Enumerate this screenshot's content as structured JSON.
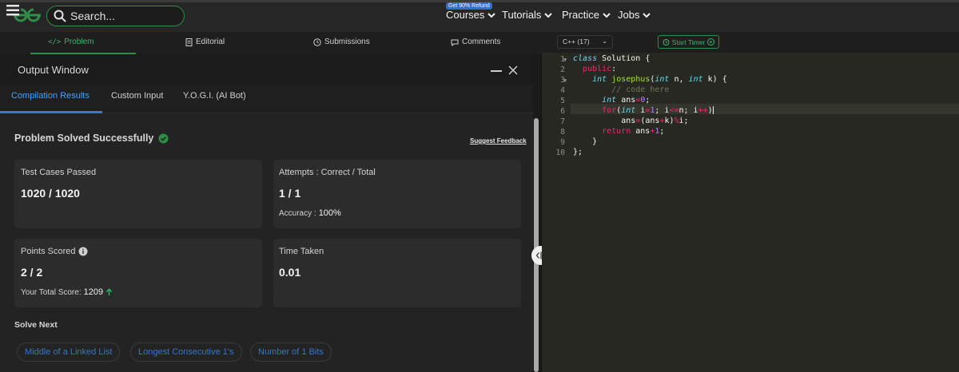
{
  "topbar": {
    "search_placeholder": "Search...",
    "nav_items": [
      {
        "label": "Courses"
      },
      {
        "label": "Tutorials"
      },
      {
        "label": "Practice"
      },
      {
        "label": "Jobs"
      }
    ],
    "courses_badge": "Get 90% Refund"
  },
  "problem_tabs": [
    {
      "label": "Problem",
      "icon": "code-icon"
    },
    {
      "label": "Editorial",
      "icon": "document-icon"
    },
    {
      "label": "Submissions",
      "icon": "clock-icon"
    },
    {
      "label": "Comments",
      "icon": "chat-icon"
    }
  ],
  "output_window": {
    "title": "Output Window",
    "tabs": [
      "Compilation Results",
      "Custom Input",
      "Y.O.G.I. (AI Bot)"
    ],
    "status": "Problem Solved Successfully",
    "suggest_feedback": "Suggest Feedback",
    "cards": {
      "test_cases": {
        "label": "Test Cases Passed",
        "value": "1020 / 1020"
      },
      "attempts": {
        "label": "Attempts : Correct / Total",
        "value": "1 / 1",
        "accuracy_label": "Accuracy :",
        "accuracy_value": "100%"
      },
      "points": {
        "label": "Points Scored",
        "value": "2 / 2",
        "total_label": "Your Total Score:",
        "total_value": "1209"
      },
      "time": {
        "label": "Time Taken",
        "value": "0.01"
      }
    },
    "solve_next_label": "Solve Next",
    "solve_next": [
      "Middle of a Linked List",
      "Longest Consecutive 1's",
      "Number of 1 Bits"
    ]
  },
  "editor": {
    "language": "C++ (17)",
    "timer_label": "Start Timer",
    "line_numbers": [
      "1",
      "2",
      "3",
      "4",
      "5",
      "6",
      "7",
      "8",
      "9",
      "10"
    ]
  },
  "colors": {
    "accent_green": "#2f8d46",
    "link_blue": "#3178c6",
    "editor_bg": "#272822"
  }
}
